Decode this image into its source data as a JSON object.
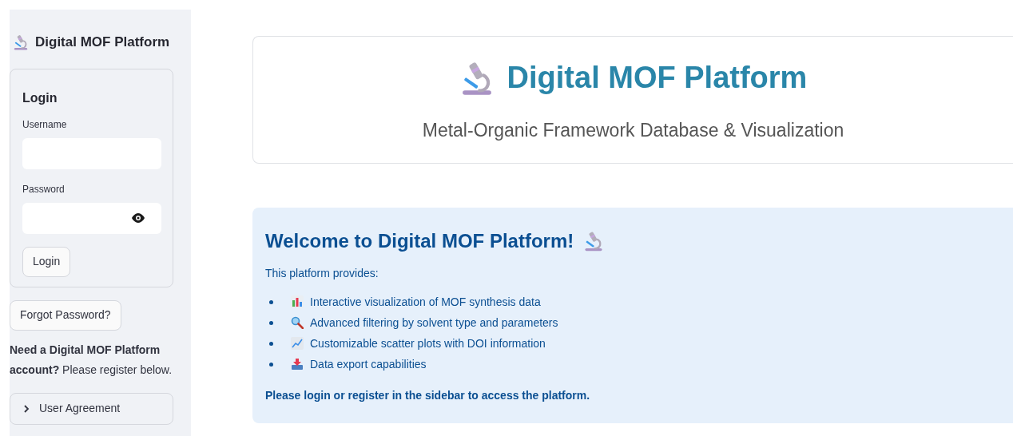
{
  "sidebar": {
    "title": "Digital MOF Platform",
    "login_form": {
      "heading": "Login",
      "username": {
        "label": "Username"
      },
      "password": {
        "label": "Password"
      },
      "submit": "Login"
    },
    "forgot_password": "Forgot Password?",
    "register_note": "**Need a Digital MOF Platform account?** Please register below.",
    "expander": {
      "label": "User Agreement",
      "expanded": false
    }
  },
  "header": {
    "title": "Digital MOF Platform",
    "subtitle": "Metal-Organic Framework Database & Visualization"
  },
  "info": {
    "title": "Welcome to Digital MOF Platform!",
    "intro": "This platform provides:",
    "features": [
      {
        "kind": "chart",
        "text": "Interactive visualization of MOF synthesis data"
      },
      {
        "kind": "search",
        "text": "Advanced filtering by solvent type and parameters"
      },
      {
        "kind": "trend",
        "text": "Customizable scatter plots with DOI information"
      },
      {
        "kind": "export",
        "text": "Data export capabilities"
      }
    ],
    "footer": "Please login or register in the sidebar to access the platform."
  }
}
